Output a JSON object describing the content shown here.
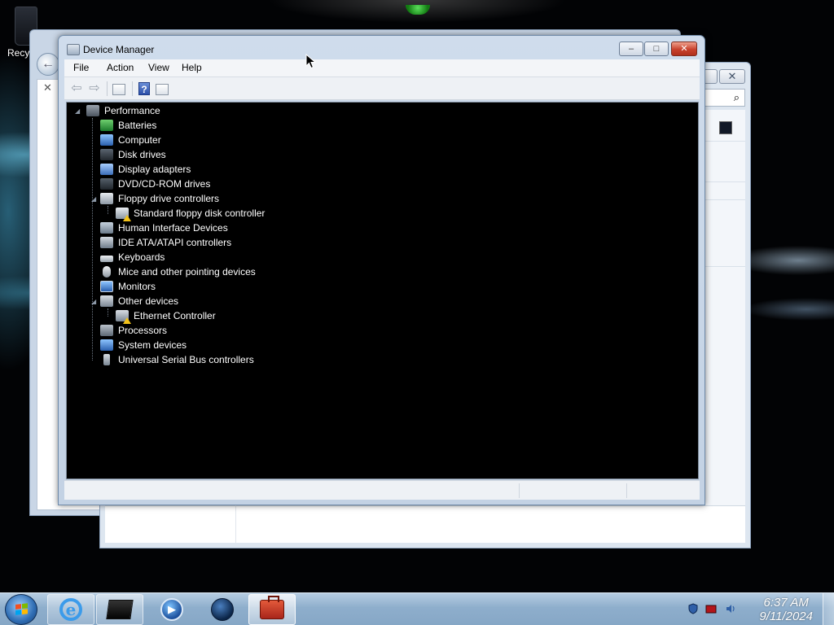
{
  "desktop": {
    "recycle_label": "Recy"
  },
  "window": {
    "title": "Device Manager",
    "menu": [
      "File",
      "Action",
      "View",
      "Help"
    ],
    "toolbar": {
      "help_glyph": "?"
    }
  },
  "tree": {
    "root": "Performance",
    "nodes": [
      {
        "label": "Batteries",
        "icon": "battery-icon"
      },
      {
        "label": "Computer",
        "icon": "computer-icon"
      },
      {
        "label": "Disk drives",
        "icon": "disk-drive-icon"
      },
      {
        "label": "Display adapters",
        "icon": "display-adapter-icon"
      },
      {
        "label": "DVD/CD-ROM drives",
        "icon": "dvd-drive-icon"
      },
      {
        "label": "Floppy drive controllers",
        "icon": "floppy-controller-icon",
        "expanded": true,
        "children": [
          {
            "label": "Standard floppy disk controller",
            "icon": "floppy-controller-icon",
            "warning": true
          }
        ]
      },
      {
        "label": "Human Interface Devices",
        "icon": "hid-icon"
      },
      {
        "label": "IDE ATA/ATAPI controllers",
        "icon": "ide-controller-icon"
      },
      {
        "label": "Keyboards",
        "icon": "keyboard-icon"
      },
      {
        "label": "Mice and other pointing devices",
        "icon": "mouse-icon"
      },
      {
        "label": "Monitors",
        "icon": "monitor-icon"
      },
      {
        "label": "Other devices",
        "icon": "unknown-device-icon",
        "expanded": true,
        "children": [
          {
            "label": "Ethernet Controller",
            "icon": "unknown-device-icon",
            "warning": true
          }
        ]
      },
      {
        "label": "Processors",
        "icon": "processor-icon"
      },
      {
        "label": "System devices",
        "icon": "system-device-icon"
      },
      {
        "label": "Universal Serial Bus controllers",
        "icon": "usb-icon"
      }
    ]
  },
  "taskbar": {
    "apps": [
      "internet-explorer-icon",
      "black-app-icon",
      "media-player-icon",
      "globe-icon",
      "toolbox-icon"
    ],
    "active_app": "toolbox-icon",
    "tray": [
      "shield-icon",
      "display-icon",
      "volume-icon"
    ],
    "clock": {
      "time": "6:37 AM",
      "date": "9/11/2024"
    }
  },
  "colors": {
    "tree_background": "#000000",
    "tree_text": "#ffffff",
    "warning": "#f2c21a",
    "close_button": "#c8412c"
  }
}
